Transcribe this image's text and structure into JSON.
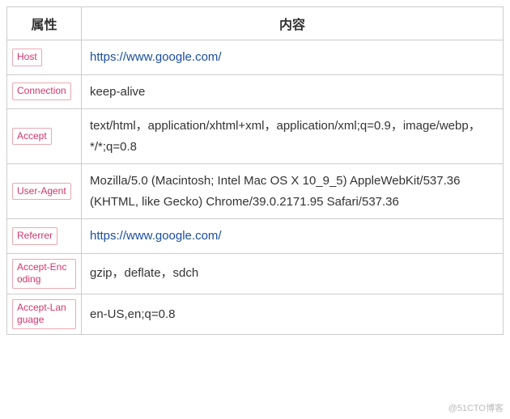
{
  "headers": {
    "attr": "属性",
    "val": "内容"
  },
  "rows": [
    {
      "attr": "Host",
      "val": "https://www.google.com/",
      "link": true
    },
    {
      "attr": "Connection",
      "val": "keep-alive"
    },
    {
      "attr": "Accept",
      "val": "text/html，application/xhtml+xml，application/xml;q=0.9，image/webp，*/*;q=0.8"
    },
    {
      "attr": "User-Agent",
      "val": "Mozilla/5.0 (Macintosh; Intel Mac OS X 10_9_5) AppleWebKit/537.36 (KHTML, like Gecko) Chrome/39.0.2171.95 Safari/537.36"
    },
    {
      "attr": "Referrer",
      "val": "https://www.google.com/",
      "link": true
    },
    {
      "attr": "Accept-Encoding",
      "val": "gzip，deflate，sdch"
    },
    {
      "attr": "Accept-Language",
      "val": "en-US,en;q=0.8"
    }
  ],
  "watermark": "@51CTO博客"
}
